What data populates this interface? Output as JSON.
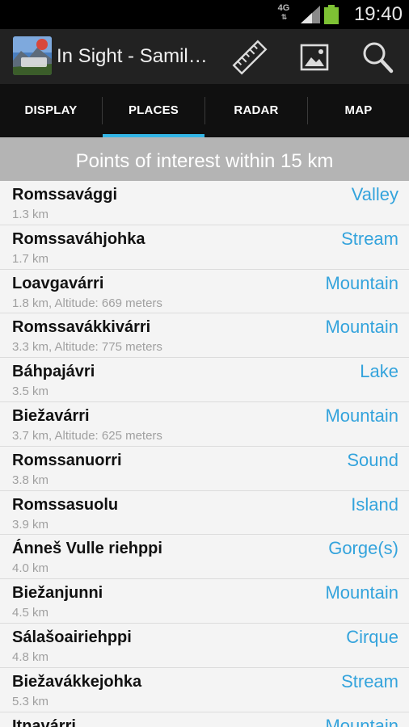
{
  "status_bar": {
    "network_label": "4G",
    "network_arrows": "⇅",
    "signal_icon": "signal-icon",
    "battery_icon": "battery-icon",
    "battery_color": "#7ec234",
    "time": "19:40"
  },
  "action_bar": {
    "app_icon": "app-icon",
    "title": "In Sight - Samil…",
    "actions": [
      {
        "icon": "ruler-icon"
      },
      {
        "icon": "image-icon"
      },
      {
        "icon": "search-icon"
      }
    ]
  },
  "tabs": [
    {
      "label": "DISPLAY",
      "selected": false
    },
    {
      "label": "PLACES",
      "selected": true
    },
    {
      "label": "RADAR",
      "selected": false
    },
    {
      "label": "MAP",
      "selected": false
    }
  ],
  "accent_color": "#33b5e5",
  "section_header": "Points of interest within 15 km",
  "places": [
    {
      "name": "Romssavággi",
      "detail": "1.3 km",
      "type": "Valley"
    },
    {
      "name": "Romssaváhjohka",
      "detail": "1.7 km",
      "type": "Stream"
    },
    {
      "name": "Loavgavárri",
      "detail": "1.8 km, Altitude: 669 meters",
      "type": "Mountain"
    },
    {
      "name": "Romssavákkivárri",
      "detail": "3.3 km, Altitude: 775 meters",
      "type": "Mountain"
    },
    {
      "name": "Báhpajávri",
      "detail": "3.5 km",
      "type": "Lake"
    },
    {
      "name": "Biežavárri",
      "detail": "3.7 km, Altitude: 625 meters",
      "type": "Mountain"
    },
    {
      "name": "Romssanuorri",
      "detail": "3.8 km",
      "type": "Sound"
    },
    {
      "name": "Romssasuolu",
      "detail": "3.9 km",
      "type": "Island"
    },
    {
      "name": "Ánneš Vulle riehppi",
      "detail": "4.0 km",
      "type": "Gorge(s)"
    },
    {
      "name": "Biežanjunni",
      "detail": "4.5 km",
      "type": "Mountain"
    },
    {
      "name": "Sálašoairiehppi",
      "detail": "4.8 km",
      "type": "Cirque"
    },
    {
      "name": "Biežavákkejohka",
      "detail": "5.3 km",
      "type": "Stream"
    },
    {
      "name": "Itnavárri",
      "detail": "",
      "type": "Mountain"
    }
  ]
}
